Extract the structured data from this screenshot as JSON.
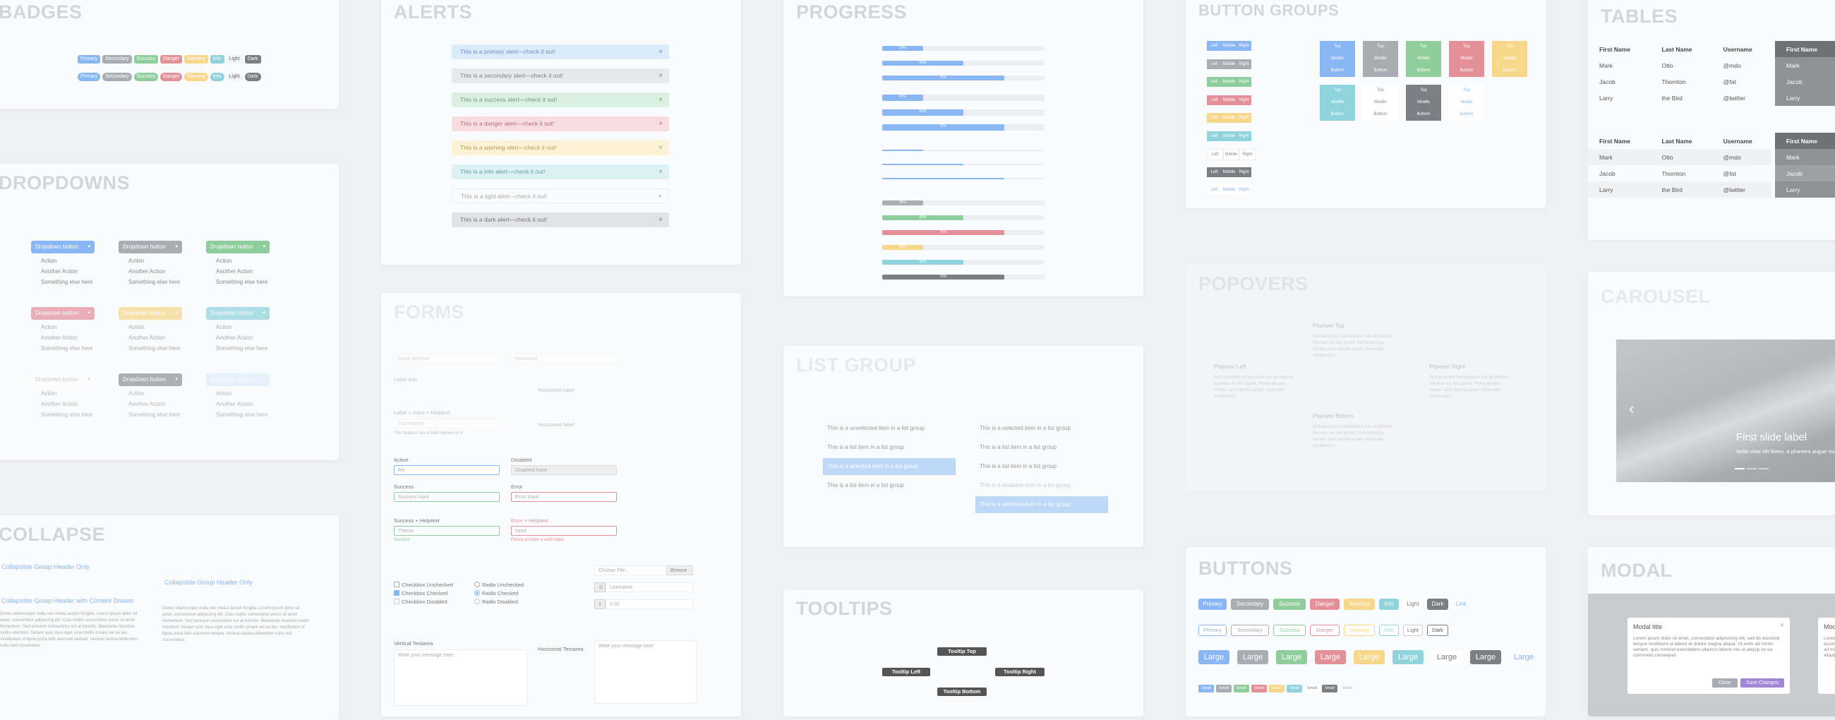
{
  "colors": {
    "primary": "#8ab6f3",
    "secondary": "#a9adb3",
    "success": "#8fce9c",
    "danger": "#e49099",
    "warning": "#f7d78a",
    "info": "#8fd3dc",
    "light": "#f1f3f5",
    "dark": "#7b7e83",
    "purple": "#a287d6"
  },
  "badges": {
    "title": "BADGES",
    "row1": [
      "Primary",
      "Secondary",
      "Success",
      "Danger",
      "Warning",
      "Info",
      "Light",
      "Dark"
    ],
    "row2": [
      "Primary",
      "Secondary",
      "Success",
      "Danger",
      "Warning",
      "Info",
      "Light",
      "Dark"
    ]
  },
  "alerts": {
    "title": "ALERTS",
    "items": [
      "This is a primary alert—check it out!",
      "This is a secondary alert—check it out!",
      "This is a success alert—check it out!",
      "This is a danger alert—check it out!",
      "This is a warning alert—check it out!",
      "This is a info alert—check it out!",
      "This is a light alert—check it out!",
      "This is a dark alert—check it out!"
    ],
    "close": "×"
  },
  "progress": {
    "title": "PROGRESS",
    "labeled": [
      {
        "label": "25%",
        "value": 0.25
      },
      {
        "label": "50%",
        "value": 0.5
      },
      {
        "label": "75%",
        "value": 0.75
      }
    ],
    "labeled2": [
      {
        "label": "25%",
        "value": 0.25
      },
      {
        "label": "50%",
        "value": 0.5
      },
      {
        "label": "75%",
        "value": 0.75
      }
    ],
    "thin": [
      {
        "value": 0.25
      },
      {
        "value": 0.5
      },
      {
        "value": 0.75
      }
    ],
    "colored": [
      {
        "label": "25%",
        "value": 0.25
      },
      {
        "label": "50%",
        "value": 0.5
      },
      {
        "label": "75%",
        "value": 0.75
      },
      {
        "label": "25%",
        "value": 0.25
      },
      {
        "label": "50%",
        "value": 0.5
      },
      {
        "label": "75%",
        "value": 0.75
      }
    ]
  },
  "button_groups": {
    "title": "BUTTON GROUPS",
    "horizontal": [
      "Left",
      "Middle",
      "Right"
    ],
    "vertical": [
      "Top",
      "Middle",
      "Bottom"
    ]
  },
  "tables": {
    "title": "TABLES",
    "headers": [
      "First Name",
      "Last Name",
      "Username"
    ],
    "rows": [
      [
        "Mark",
        "Otto",
        "@mdo"
      ],
      [
        "Jacob",
        "Thornton",
        "@fat"
      ],
      [
        "Larry",
        "the Bird",
        "@twitter"
      ]
    ],
    "dark_header": "First Name",
    "dark_rows": [
      "Mark",
      "Jacob",
      "Larry"
    ]
  },
  "dropdowns": {
    "title": "DROPDOWNS",
    "button_label": "Dropdown button",
    "menu": [
      "Action",
      "Another Action",
      "Something else here"
    ]
  },
  "forms": {
    "title": "FORMS",
    "fields": {
      "email_placeholder": "Email address",
      "password_placeholder": "Password",
      "label_text": "Label text",
      "label_input": "Label + Input + Helptext",
      "placeholder": "Placeholder",
      "helper": "This helptext has a bold element in it.",
      "horizontal_label": "Horizontal label",
      "active": "Active",
      "disabled": "Disabled",
      "active_value": "My",
      "disabled_value": "Disabled Input",
      "success": "Success",
      "success_value": "Success Input",
      "error": "Error",
      "error_value": "Error Input",
      "success_helptext": "Success + Helptext",
      "error_helptext": "Error + Helptext",
      "success_value2": "Theme",
      "error_value2": "Input",
      "success_note": "Success",
      "error_note": "Please provide a valid value",
      "cb_unchecked": "Checkbox Unchecked",
      "cb_checked": "Checkbox Checked",
      "cb_disabled": "Checkbox Disabled",
      "rd_unchecked": "Radio Unchecked",
      "rd_checked": "Radio Checked",
      "rd_disabled": "Radio Disabled",
      "file_placeholder": "Choose File...",
      "browse": "Browse",
      "at": "@",
      "username": "Username",
      "dollar": "$",
      "amount": "0.00",
      "vertical_textarea": "Vertical Textarea",
      "horizontal_textarea": "Horizontal Textarea",
      "textarea_placeholder": "Write your message here"
    }
  },
  "collapse": {
    "title": "COLLAPSE",
    "header1": "Collapsible Group Header Only",
    "header2": "Collapsible Group Header with Content Drawer",
    "header3": "Collapsible Group Header Only",
    "body": "Donec ullamcorper nulla non metus auctor fringilla. Lorem ipsum dolor sit amet, consectetur adipiscing elit. Cras mattis consectetur purus sit amet fermentum. Sed posuere consectetur est at lobortis. Maecenas faucibus mollis interdum. Nullam quis risus eget urna mollis ornare vel eu leo. Vestibulum id ligula porta felis euismod semper. Aenean lacinia bibendum nulla sed consectetur."
  },
  "list_group": {
    "title": "LIST GROUP",
    "left": [
      "This is a unselected item in a list group",
      "This is a list item in a list group",
      "This is a selected item in a list group",
      "This is a list item in a list group"
    ],
    "right": [
      "This is a selected item in a list group",
      "This is a list item in a list group",
      "This is a list item in a list group",
      "This is a disabled item in a list group",
      "This is a selected item in a list group"
    ]
  },
  "popovers": {
    "title": "POPOVERS",
    "top": "Popover Top",
    "left": "Popover Left",
    "right": "Popover Right",
    "bottom": "Popover Bottom",
    "body": "Sed posuere consectetur est at lobortis. Aenean eu leo quam. Pellentesque ornare sem lacinia quam venenatis vestibulum."
  },
  "carousel": {
    "title": "CAROUSEL",
    "slide_label": "First slide label",
    "slide_text": "Nulla vitae elit libero, a pharetra augue mollis interdum.",
    "prev": "‹"
  },
  "buttons": {
    "title": "BUTTONS",
    "labels": [
      "Primary",
      "Secondary",
      "Success",
      "Danger",
      "Warning",
      "Info",
      "Light",
      "Dark",
      "Link"
    ],
    "large": "Large",
    "small": "Small"
  },
  "tooltips": {
    "title": "TOOLTIPS",
    "top": "Tooltip Top",
    "left": "Tooltip Left",
    "right": "Tooltip Right",
    "bottom": "Tooltip Bottom"
  },
  "modal": {
    "title": "MODAL",
    "modal_title": "Modal title",
    "body": "Lorem ipsum dolor sit amet, consectetur adipisicing elit, sed do eiusmod tempor incididunt ut labore et dolore magna aliqua. Ut enim ad minim veniam, quis nostrud exercitation ullamco laboris nisi ut aliquip ex ea commodo consequat.",
    "close": "Close",
    "save": "Save Changes",
    "x": "×"
  }
}
